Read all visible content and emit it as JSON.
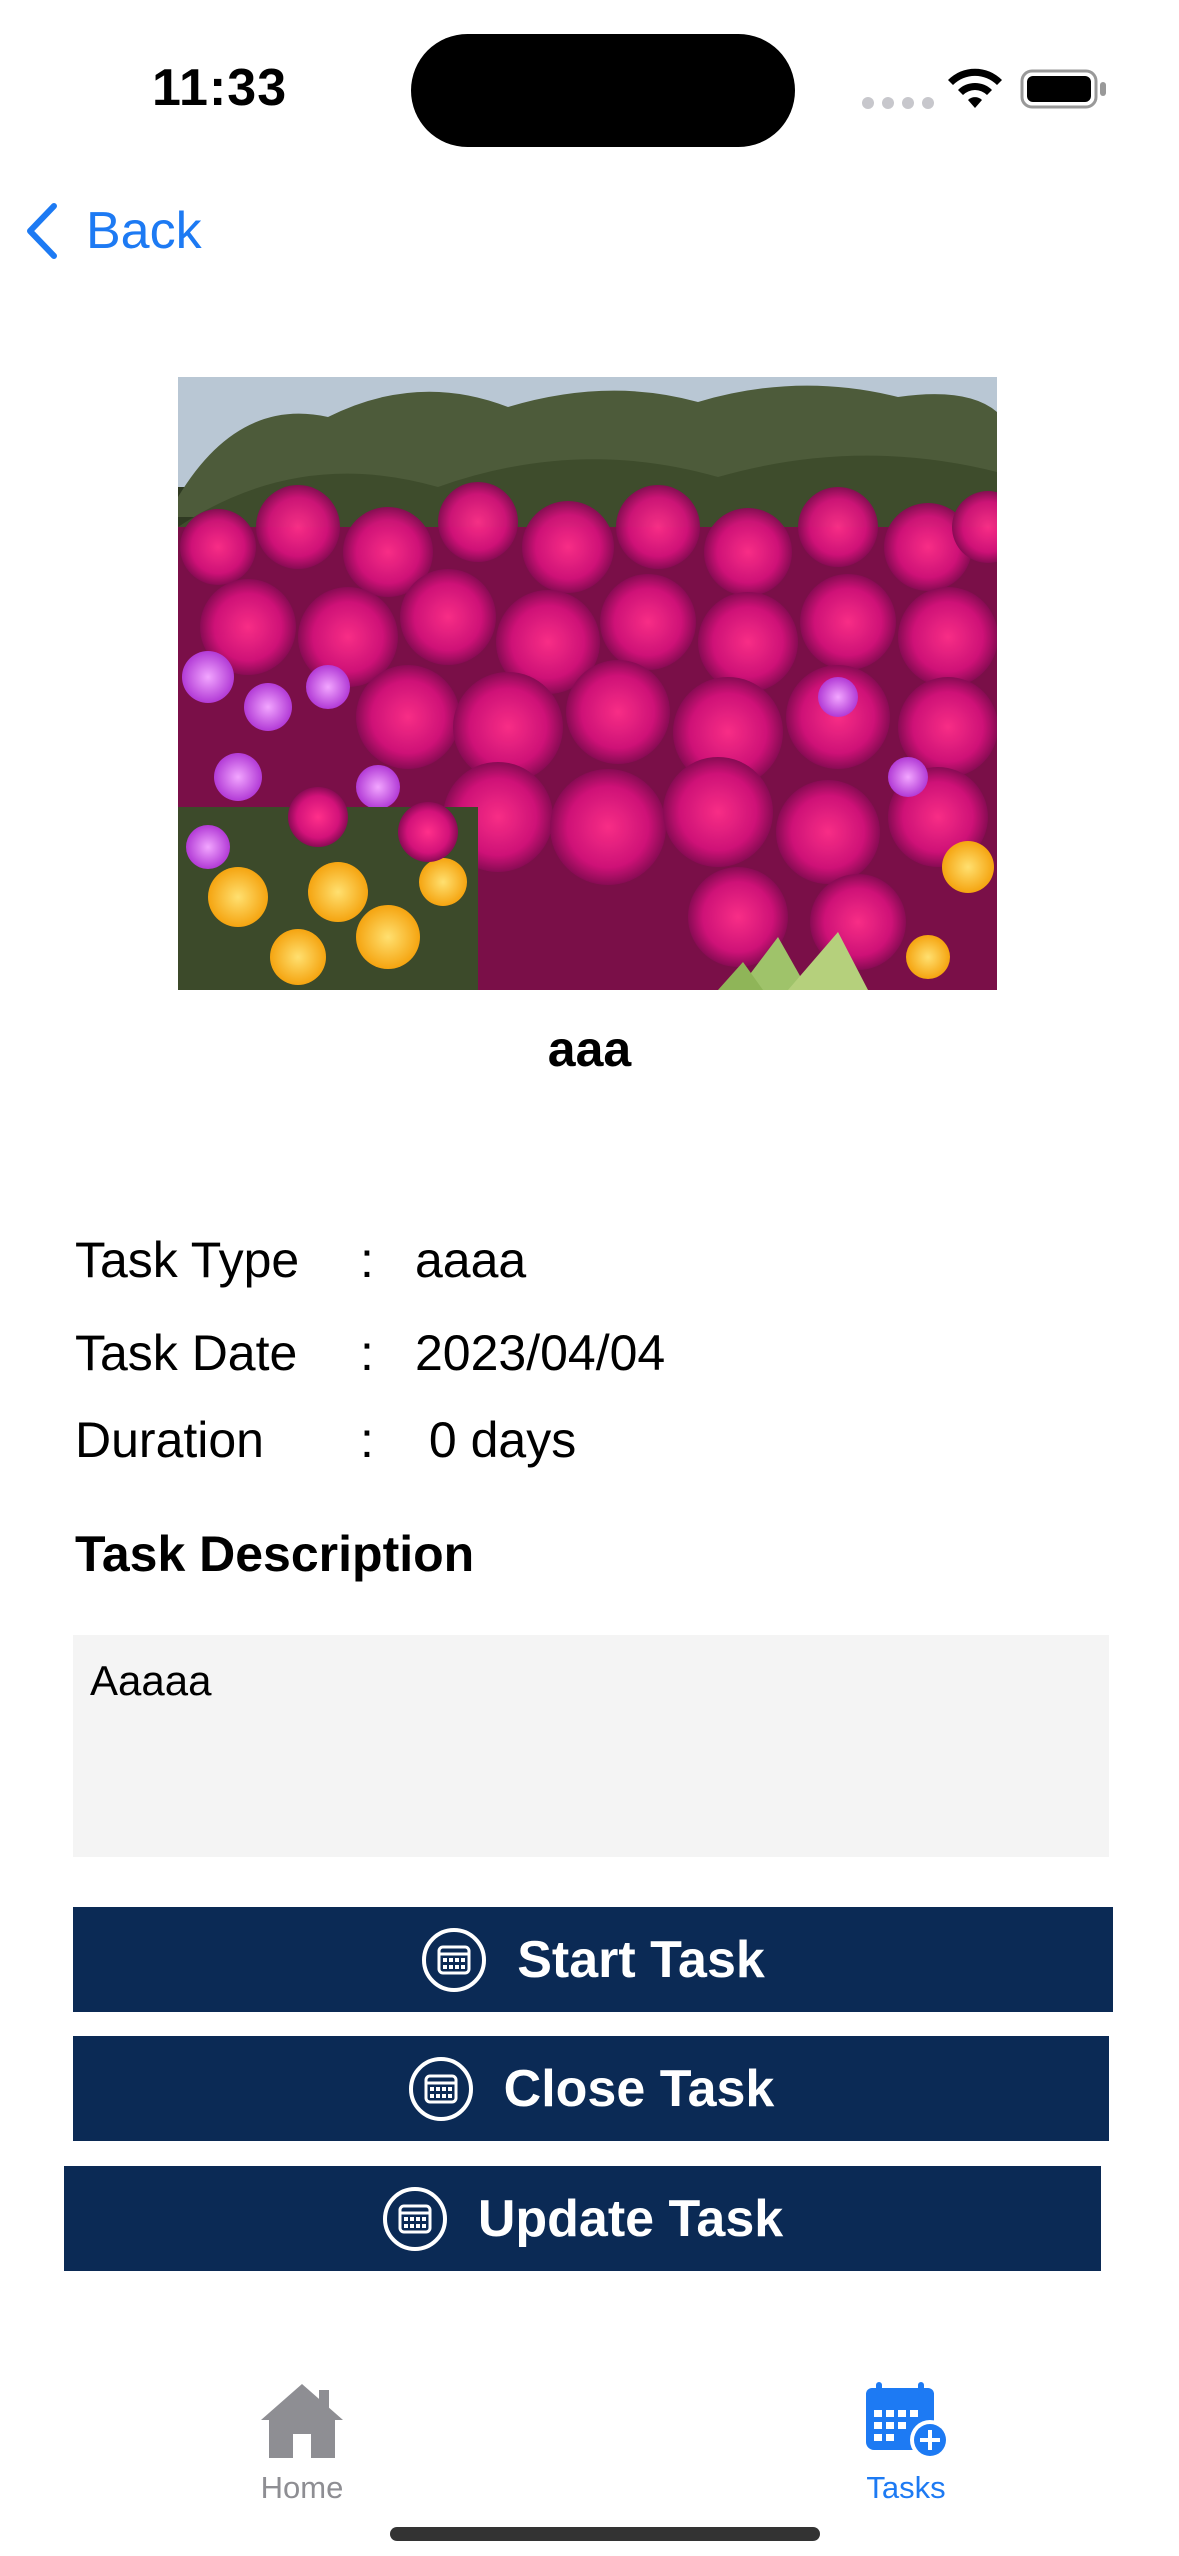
{
  "status_bar": {
    "time": "11:33"
  },
  "nav": {
    "back_label": "Back"
  },
  "task": {
    "title": "aaa",
    "image_alt": "pink and yellow flowers"
  },
  "details": [
    {
      "label": "Task Type",
      "separator": ":",
      "value": "aaaa"
    },
    {
      "label": "Task Date",
      "separator": ":",
      "value": "2023/04/04"
    },
    {
      "label": "Duration",
      "separator": ":",
      "value": " 0 days"
    }
  ],
  "description": {
    "heading": "Task Description",
    "text": "Aaaaa"
  },
  "actions": {
    "start_label": "Start Task",
    "close_label": "Close Task",
    "update_label": "Update Task"
  },
  "tab_bar": {
    "home_label": "Home",
    "tasks_label": "Tasks",
    "active": "Tasks"
  },
  "colors": {
    "accent": "#1d7af3",
    "button_bg": "#0b2a55",
    "inactive_tab": "#8e8e93",
    "desc_bg": "#f4f4f4"
  },
  "icons": {
    "back": "chevron-left-icon",
    "button": "calendar-circle-icon",
    "home_tab": "house-icon",
    "tasks_tab": "calendar-plus-icon"
  }
}
